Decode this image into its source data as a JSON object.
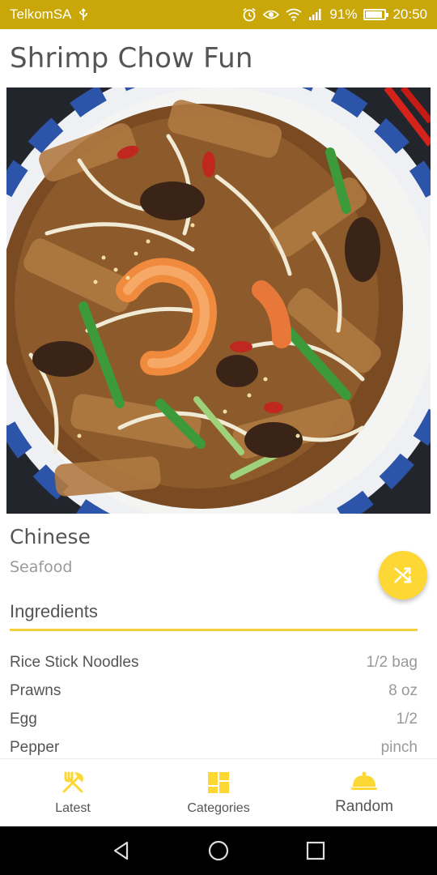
{
  "status_bar": {
    "carrier": "TelkomSA",
    "battery": "91%",
    "battery_level": 0.91,
    "time": "20:50"
  },
  "meal": {
    "title": "Shrimp Chow Fun",
    "cuisine": "Chinese",
    "category": "Seafood"
  },
  "ingredients": {
    "heading": "Ingredients",
    "items": [
      {
        "name": "Rice Stick Noodles",
        "quantity": "1/2 bag"
      },
      {
        "name": "Prawns",
        "quantity": "8 oz"
      },
      {
        "name": "Egg",
        "quantity": "1/2"
      },
      {
        "name": "Pepper",
        "quantity": "pinch"
      }
    ]
  },
  "fab": {
    "icon": "shuffle-icon"
  },
  "bottom_nav": {
    "latest": "Latest",
    "categories": "Categories",
    "random": "Random"
  },
  "colors": {
    "status_bar": "#c9a708",
    "accent": "#fdd835",
    "divider": "#f2d13a"
  }
}
